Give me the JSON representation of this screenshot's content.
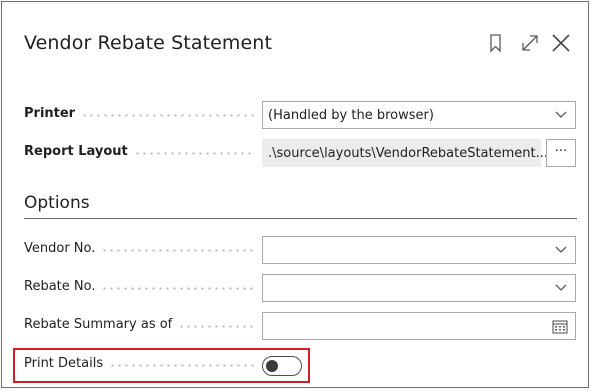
{
  "dialog": {
    "title": "Vendor Rebate Statement",
    "icons": [
      "bookmark-icon",
      "expand-icon",
      "close-icon"
    ]
  },
  "printer": {
    "label": "Printer",
    "value": "(Handled by the browser)"
  },
  "report_layout": {
    "label": "Report Layout",
    "value": ".\\source\\layouts\\VendorRebateStatement....",
    "button": "···"
  },
  "options": {
    "title": "Options",
    "vendor_no": {
      "label": "Vendor No.",
      "value": ""
    },
    "rebate_no": {
      "label": "Rebate No.",
      "value": ""
    },
    "rebate_summary": {
      "label": "Rebate Summary as of",
      "value": ""
    },
    "print_details": {
      "label": "Print Details",
      "checked": false
    }
  },
  "colors": {
    "highlight": "#d01f2c",
    "border": "#a9a9a9",
    "readonly_bg": "#ececec"
  }
}
